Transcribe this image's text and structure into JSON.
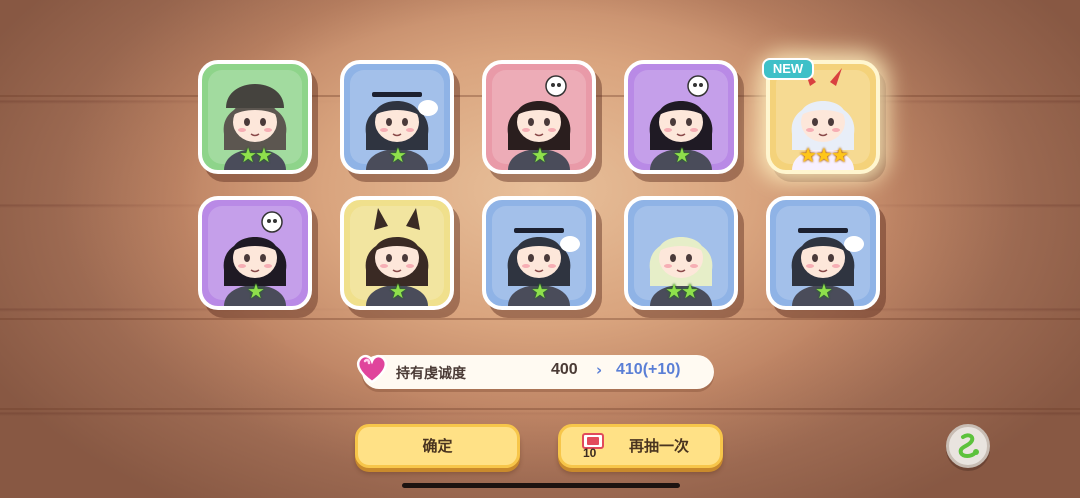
{
  "cards": [
    {
      "bg": "green",
      "stars": 2,
      "star_color": "green",
      "portrait_icon": "soldier-helmet-character",
      "hair": "#5c5650",
      "is_new": false
    },
    {
      "bg": "blue",
      "stars": 1,
      "star_color": "green",
      "portrait_icon": "headband-girl-with-bowl",
      "hair": "#2f3440",
      "is_new": false
    },
    {
      "bg": "pink",
      "stars": 1,
      "star_color": "green",
      "portrait_icon": "skull-hat-girl",
      "hair": "#2a1e1e",
      "is_new": false
    },
    {
      "bg": "purple",
      "stars": 1,
      "star_color": "green",
      "portrait_icon": "skull-hat-long-hair-girl",
      "hair": "#1f1a24",
      "is_new": false
    },
    {
      "bg": "gold",
      "stars": 3,
      "star_color": "gold",
      "portrait_icon": "white-hair-horned-girl",
      "hair": "#e8eef8",
      "is_new": true
    },
    {
      "bg": "purple",
      "stars": 1,
      "star_color": "green",
      "portrait_icon": "skull-hat-long-hair-girl",
      "hair": "#1f1a24",
      "is_new": false
    },
    {
      "bg": "yellow",
      "stars": 1,
      "star_color": "green",
      "portrait_icon": "wolf-ear-girl",
      "hair": "#3a2a24",
      "is_new": false
    },
    {
      "bg": "blue",
      "stars": 1,
      "star_color": "green",
      "portrait_icon": "headband-girl-with-bowl",
      "hair": "#2f3440",
      "is_new": false
    },
    {
      "bg": "blue",
      "stars": 2,
      "star_color": "green",
      "portrait_icon": "green-hair-girl",
      "hair": "#e6eec8",
      "is_new": false
    },
    {
      "bg": "blue",
      "stars": 1,
      "star_color": "green",
      "portrait_icon": "headband-girl-with-bowl",
      "hair": "#2f3440",
      "is_new": false
    }
  ],
  "new_badge": "NEW",
  "devotion": {
    "label": "持有虔诚度",
    "old_value": "400",
    "arrow": "›",
    "new_value": "410(+10)",
    "icon": "heart-gem-icon"
  },
  "buttons": {
    "confirm_label": "确定",
    "redraw_label": "再抽一次",
    "ticket_count": "10",
    "ticket_icon": "ticket-icon"
  },
  "side_button_icon": "swirl-icon",
  "colors": {
    "card_green": "#8ed48a",
    "card_blue": "#8fb3e6",
    "card_pink": "#e99aa8",
    "card_purple": "#b98ae6",
    "card_yellow": "#f0e08c",
    "card_gold": "#f4d27a",
    "button_fill": "#ffe186",
    "highlight_value": "#5a7fd6",
    "new_badge": "#3ec0c8"
  }
}
